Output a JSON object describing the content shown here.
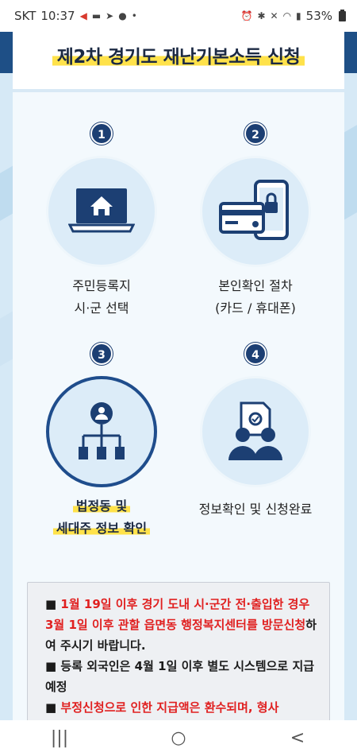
{
  "status_bar": {
    "carrier": "SKT",
    "time": "10:37",
    "battery": "53%"
  },
  "header": {
    "title": "제2차 경기도 재난기본소득 신청"
  },
  "steps": [
    {
      "number": "1",
      "line1": "주민등록지",
      "line2": "시·군 선택",
      "icon": "laptop-home-icon"
    },
    {
      "number": "2",
      "line1": "본인확인 절차",
      "line2": "(카드 / 휴대폰)",
      "icon": "card-phone-lock-icon"
    },
    {
      "number": "3",
      "line1": "법정동 및",
      "line2": "세대주 정보 확인",
      "icon": "org-chart-icon"
    },
    {
      "number": "4",
      "line1": "정보확인 및 신청완료",
      "line2": "",
      "icon": "people-document-icon"
    }
  ],
  "notice": {
    "items": [
      {
        "bullet": "■",
        "red_text": "1월 19일 이후 경기 도내 시·군간 전·출입한 경우 3월 1일 이후 관할 읍면동 행정복지센터를 방문신청",
        "text": "하여 주시기 바랍니다."
      },
      {
        "bullet": "■",
        "red_text": "",
        "text": "등록 외국인은 4월 1일 이후 별도 시스템으로 지급 예정"
      },
      {
        "bullet": "■",
        "red_text": "부정신청으로 인한 지급액은 환수되며, 형사",
        "text": ""
      }
    ]
  },
  "colors": {
    "navy": "#1c3f73",
    "highlight": "#ffe24a",
    "alert_red": "#e02020",
    "circle_bg": "#dcecf8"
  },
  "nav_bar": {
    "recents": "|||",
    "home": "○",
    "back": "<"
  }
}
